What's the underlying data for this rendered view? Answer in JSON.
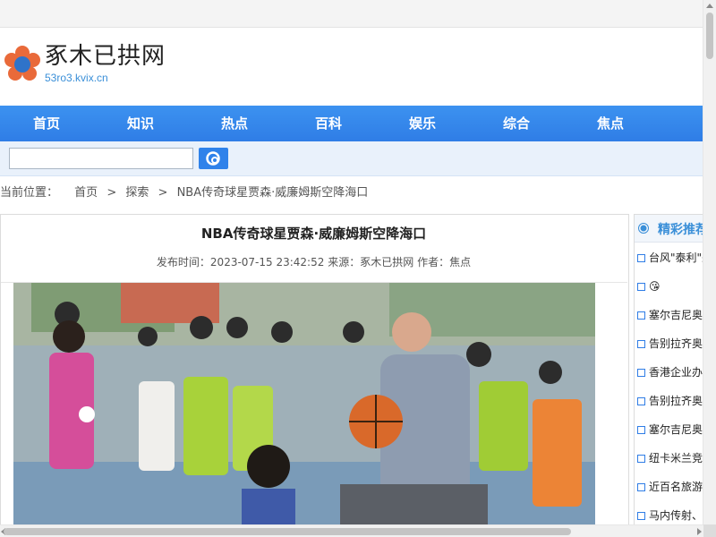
{
  "site": {
    "name": "豖木已拱网",
    "domain": "53ro3.kvix.cn"
  },
  "nav": [
    "首页",
    "知识",
    "热点",
    "百科",
    "娱乐",
    "综合",
    "焦点"
  ],
  "search": {
    "value": "",
    "placeholder": ""
  },
  "breadcrumb": {
    "label": "当前位置：",
    "items": [
      "首页",
      "探索",
      "NBA传奇球星贾森·威廉姆斯空降海口"
    ],
    "separator": ">"
  },
  "article": {
    "title": "NBA传奇球星贾森·威廉姆斯空降海口",
    "meta": {
      "time_label": "发布时间：",
      "time": "2023-07-15 23:42:52",
      "source_label": "来源：",
      "source": "豖木已拱网",
      "author_label": "作者：",
      "author": "焦点"
    },
    "image_alt": "篮球教练与孩子们在户外球场"
  },
  "sidebar": {
    "title": "精彩推荐",
    "items": [
      "台风\"泰利\"来",
      "😘",
      "塞尔吉尼奥",
      "告别拉齐奥",
      "香港企业办",
      "告别拉齐奥",
      "塞尔吉尼奥",
      "纽卡米兰竞",
      "近百名旅游",
      "马内传射、"
    ]
  },
  "colors": {
    "nav": "#2f7de6",
    "accent": "#3a8fd8"
  }
}
